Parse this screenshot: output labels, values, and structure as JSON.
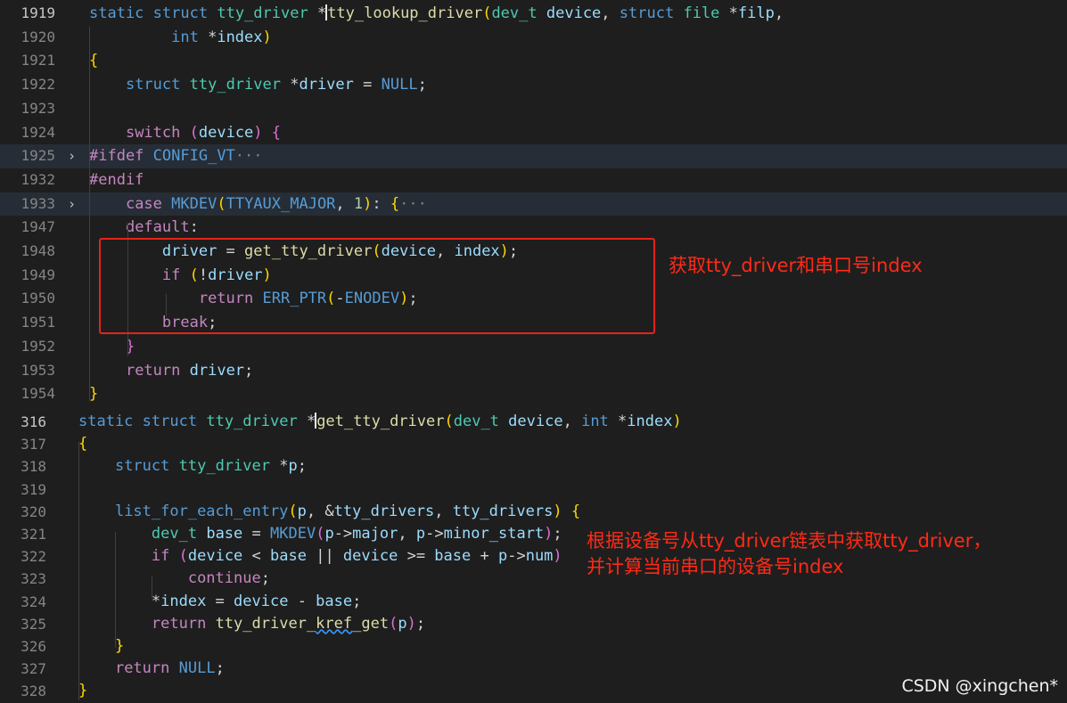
{
  "top_editor": {
    "lines": [
      {
        "num": "1919",
        "current": true,
        "tokens": [
          [
            "k",
            "static"
          ],
          [
            "",
            " "
          ],
          [
            "k",
            "struct"
          ],
          [
            "",
            " "
          ],
          [
            "t",
            "tty_driver"
          ],
          [
            "",
            " *"
          ],
          [
            "cursor",
            ""
          ],
          [
            "f",
            "tty_lookup_driver"
          ],
          [
            "br",
            "("
          ],
          [
            "t",
            "dev_t"
          ],
          [
            "",
            " "
          ],
          [
            "v",
            "device"
          ],
          [
            ", "
          ],
          [
            "k",
            "struct"
          ],
          [
            "",
            " "
          ],
          [
            "t",
            "file"
          ],
          [
            "",
            " *"
          ],
          [
            "v",
            "filp"
          ],
          [
            ","
          ]
        ]
      },
      {
        "num": "1920",
        "tokens": [
          [
            "",
            "         "
          ],
          [
            "k",
            "int"
          ],
          [
            "",
            " *"
          ],
          [
            "v",
            "index"
          ],
          [
            "br",
            ")"
          ]
        ]
      },
      {
        "num": "1921",
        "tokens": [
          [
            "br",
            "{"
          ]
        ]
      },
      {
        "num": "1922",
        "tokens": [
          [
            "",
            "    "
          ],
          [
            "k",
            "struct"
          ],
          [
            "",
            " "
          ],
          [
            "t",
            "tty_driver"
          ],
          [
            "",
            " *"
          ],
          [
            "v",
            "driver"
          ],
          [
            "",
            " = "
          ],
          [
            "mac",
            "NULL"
          ],
          [
            "",
            ";"
          ]
        ]
      },
      {
        "num": "1923",
        "tokens": []
      },
      {
        "num": "1924",
        "tokens": [
          [
            "",
            "    "
          ],
          [
            "c",
            "switch"
          ],
          [
            "",
            " "
          ],
          [
            "pb",
            "("
          ],
          [
            "v",
            "device"
          ],
          [
            "pb",
            ")"
          ],
          [
            "",
            " "
          ],
          [
            "pb",
            "{"
          ]
        ]
      },
      {
        "num": "1925",
        "fold": "›",
        "hl": true,
        "tokens": [
          [
            "c",
            "#ifdef"
          ],
          [
            "",
            " "
          ],
          [
            "mac",
            "CONFIG_VT"
          ],
          [
            "dim",
            "···"
          ]
        ]
      },
      {
        "num": "1932",
        "tokens": [
          [
            "c",
            "#endif"
          ]
        ]
      },
      {
        "num": "1933",
        "fold": "›",
        "hl": true,
        "tokens": [
          [
            "",
            "    "
          ],
          [
            "c",
            "case"
          ],
          [
            "",
            " "
          ],
          [
            "mac",
            "MKDEV"
          ],
          [
            "br",
            "("
          ],
          [
            "mac",
            "TTYAUX_MAJOR"
          ],
          [
            "",
            ", "
          ],
          [
            "n",
            "1"
          ],
          [
            "br",
            ")"
          ],
          [
            "",
            ": "
          ],
          [
            "br",
            "{"
          ],
          [
            "dim",
            "···"
          ]
        ]
      },
      {
        "num": "1947",
        "tokens": [
          [
            "",
            "    "
          ],
          [
            "c",
            "default"
          ],
          [
            "",
            ":"
          ]
        ]
      },
      {
        "num": "1948",
        "tokens": [
          [
            "",
            "        "
          ],
          [
            "v",
            "driver"
          ],
          [
            "",
            " = "
          ],
          [
            "f",
            "get_tty_driver"
          ],
          [
            "br",
            "("
          ],
          [
            "v",
            "device"
          ],
          [
            "",
            ", "
          ],
          [
            "v",
            "index"
          ],
          [
            "br",
            ")"
          ],
          [
            "",
            ";"
          ]
        ]
      },
      {
        "num": "1949",
        "tokens": [
          [
            "",
            "        "
          ],
          [
            "c",
            "if"
          ],
          [
            "",
            " "
          ],
          [
            "br",
            "("
          ],
          [
            "",
            "!"
          ],
          [
            "v",
            "driver"
          ],
          [
            "br",
            ")"
          ]
        ]
      },
      {
        "num": "1950",
        "tokens": [
          [
            "",
            "            "
          ],
          [
            "c",
            "return"
          ],
          [
            "",
            " "
          ],
          [
            "mac",
            "ERR_PTR"
          ],
          [
            "br",
            "("
          ],
          [
            "",
            "-"
          ],
          [
            "mac",
            "ENODEV"
          ],
          [
            "br",
            ")"
          ],
          [
            "",
            ";"
          ]
        ]
      },
      {
        "num": "1951",
        "tokens": [
          [
            "",
            "        "
          ],
          [
            "c",
            "break"
          ],
          [
            "",
            ";"
          ]
        ]
      },
      {
        "num": "1952",
        "tokens": [
          [
            "",
            "    "
          ],
          [
            "pb",
            "}"
          ]
        ]
      },
      {
        "num": "1953",
        "tokens": [
          [
            "",
            "    "
          ],
          [
            "c",
            "return"
          ],
          [
            "",
            " "
          ],
          [
            "v",
            "driver"
          ],
          [
            "",
            ";"
          ]
        ]
      },
      {
        "num": "1954",
        "tokens": [
          [
            "br",
            "}"
          ]
        ]
      }
    ]
  },
  "bottom_editor": {
    "lines": [
      {
        "num": "316",
        "current": true,
        "tokens": [
          [
            "k",
            "static"
          ],
          [
            "",
            " "
          ],
          [
            "k",
            "struct"
          ],
          [
            "",
            " "
          ],
          [
            "t",
            "tty_driver"
          ],
          [
            "",
            " *"
          ],
          [
            "cursor",
            ""
          ],
          [
            "f",
            "get_tty_driver"
          ],
          [
            "br",
            "("
          ],
          [
            "t",
            "dev_t"
          ],
          [
            "",
            " "
          ],
          [
            "v",
            "device"
          ],
          [
            "",
            ", "
          ],
          [
            "k",
            "int"
          ],
          [
            "",
            " *"
          ],
          [
            "v",
            "index"
          ],
          [
            "br",
            ")"
          ]
        ]
      },
      {
        "num": "317",
        "tokens": [
          [
            "br",
            "{"
          ]
        ]
      },
      {
        "num": "318",
        "tokens": [
          [
            "",
            "    "
          ],
          [
            "k",
            "struct"
          ],
          [
            "",
            " "
          ],
          [
            "t",
            "tty_driver"
          ],
          [
            "",
            " *"
          ],
          [
            "v",
            "p"
          ],
          [
            "",
            ";"
          ]
        ]
      },
      {
        "num": "319",
        "tokens": []
      },
      {
        "num": "320",
        "tokens": [
          [
            "",
            "    "
          ],
          [
            "mac",
            "list_for_each_entry"
          ],
          [
            "br",
            "("
          ],
          [
            "v",
            "p"
          ],
          [
            "",
            ", &"
          ],
          [
            "v",
            "tty_drivers"
          ],
          [
            "",
            ", "
          ],
          [
            "v",
            "tty_drivers"
          ],
          [
            "br",
            ")"
          ],
          [
            "",
            " "
          ],
          [
            "br",
            "{"
          ]
        ]
      },
      {
        "num": "321",
        "tokens": [
          [
            "",
            "        "
          ],
          [
            "t",
            "dev_t"
          ],
          [
            "",
            " "
          ],
          [
            "v",
            "base"
          ],
          [
            "",
            " = "
          ],
          [
            "mac",
            "MKDEV"
          ],
          [
            "pb",
            "("
          ],
          [
            "v",
            "p"
          ],
          [
            "",
            "->"
          ],
          [
            "v",
            "major"
          ],
          [
            "",
            ", "
          ],
          [
            "v",
            "p"
          ],
          [
            "",
            "->"
          ],
          [
            "v",
            "minor_start"
          ],
          [
            "pb",
            ")"
          ],
          [
            "",
            ";"
          ]
        ]
      },
      {
        "num": "322",
        "tokens": [
          [
            "",
            "        "
          ],
          [
            "c",
            "if"
          ],
          [
            "",
            " "
          ],
          [
            "pb",
            "("
          ],
          [
            "v",
            "device"
          ],
          [
            "",
            " < "
          ],
          [
            "v",
            "base"
          ],
          [
            "",
            " || "
          ],
          [
            "v",
            "device"
          ],
          [
            "",
            " >= "
          ],
          [
            "v",
            "base"
          ],
          [
            "",
            " + "
          ],
          [
            "v",
            "p"
          ],
          [
            "",
            "->"
          ],
          [
            "v",
            "num"
          ],
          [
            "pb",
            ")"
          ]
        ]
      },
      {
        "num": "323",
        "tokens": [
          [
            "",
            "            "
          ],
          [
            "c",
            "continue"
          ],
          [
            "",
            ";"
          ]
        ]
      },
      {
        "num": "324",
        "tokens": [
          [
            "",
            "        *"
          ],
          [
            "v",
            "index"
          ],
          [
            "",
            " = "
          ],
          [
            "v",
            "device"
          ],
          [
            "",
            " - "
          ],
          [
            "v",
            "base"
          ],
          [
            "",
            ";"
          ]
        ]
      },
      {
        "num": "325",
        "tokens": [
          [
            "",
            "        "
          ],
          [
            "c",
            "return"
          ],
          [
            "",
            " "
          ],
          [
            "f",
            "tty_driver_"
          ],
          [
            "fsq",
            "kref"
          ],
          [
            "f",
            "_get"
          ],
          [
            "pb",
            "("
          ],
          [
            "v",
            "p"
          ],
          [
            "pb",
            ")"
          ],
          [
            "",
            ";"
          ]
        ]
      },
      {
        "num": "326",
        "tokens": [
          [
            "",
            "    "
          ],
          [
            "br",
            "}"
          ]
        ]
      },
      {
        "num": "327",
        "tokens": [
          [
            "",
            "    "
          ],
          [
            "c",
            "return"
          ],
          [
            "",
            " "
          ],
          [
            "mac",
            "NULL"
          ],
          [
            "",
            ";"
          ]
        ]
      },
      {
        "num": "328",
        "tokens": [
          [
            "br",
            "}"
          ]
        ]
      }
    ]
  },
  "annotations": {
    "top_note": "获取tty_driver和串口号index",
    "bottom_note_line1": "根据设备号从tty_driver链表中获取tty_driver，",
    "bottom_note_line2": "并计算当前串口的设备号index"
  },
  "watermark": "CSDN @xingchen*",
  "colors": {
    "annotation_red": "#e5231b",
    "background": "#1e1e1e"
  }
}
